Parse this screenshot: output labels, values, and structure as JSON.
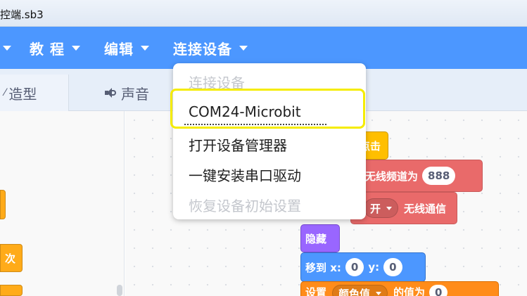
{
  "window": {
    "title": "控端.sb3"
  },
  "menubar": {
    "items": [
      {
        "label": "教 程"
      },
      {
        "label": "编辑"
      },
      {
        "label": "连接设备"
      }
    ]
  },
  "tabs": {
    "costumes": "造型",
    "sounds": "声音"
  },
  "dropdown": {
    "items": [
      {
        "label": "连接设备",
        "enabled": false
      },
      {
        "label": "COM24-Microbit",
        "enabled": true,
        "highlighted": true
      },
      {
        "label": "打开设备管理器",
        "enabled": true
      },
      {
        "label": "一键安装串口驱动",
        "enabled": true
      },
      {
        "label": "恢复设备初始设置",
        "enabled": false
      }
    ]
  },
  "palette": {
    "blocks": [
      {
        "label": ""
      },
      {
        "label": "次"
      },
      {
        "label": ""
      }
    ]
  },
  "code": {
    "event_block": {
      "text": "点击"
    },
    "radio_channel_block": {
      "text": "无线频道为",
      "value": "888"
    },
    "radio_toggle_block": {
      "option": "开",
      "text": "无线通信"
    },
    "hide_block": {
      "text": "隐藏"
    },
    "goto_block": {
      "text": "移到 x:",
      "x_value": "0",
      "y_label": "y:",
      "y_value": "0"
    },
    "set_effect_block": {
      "text": "设置",
      "option": "颜色值",
      "suffix": "的值为",
      "value": "0"
    }
  },
  "colors": {
    "menubar": "#4c97ff",
    "events": "#ffbf00",
    "radio": "#e96a6a",
    "looks": "#9966ff",
    "motion": "#4c97ff",
    "looks_orange": "#ff8c1a",
    "highlight": "#f5ec00"
  }
}
